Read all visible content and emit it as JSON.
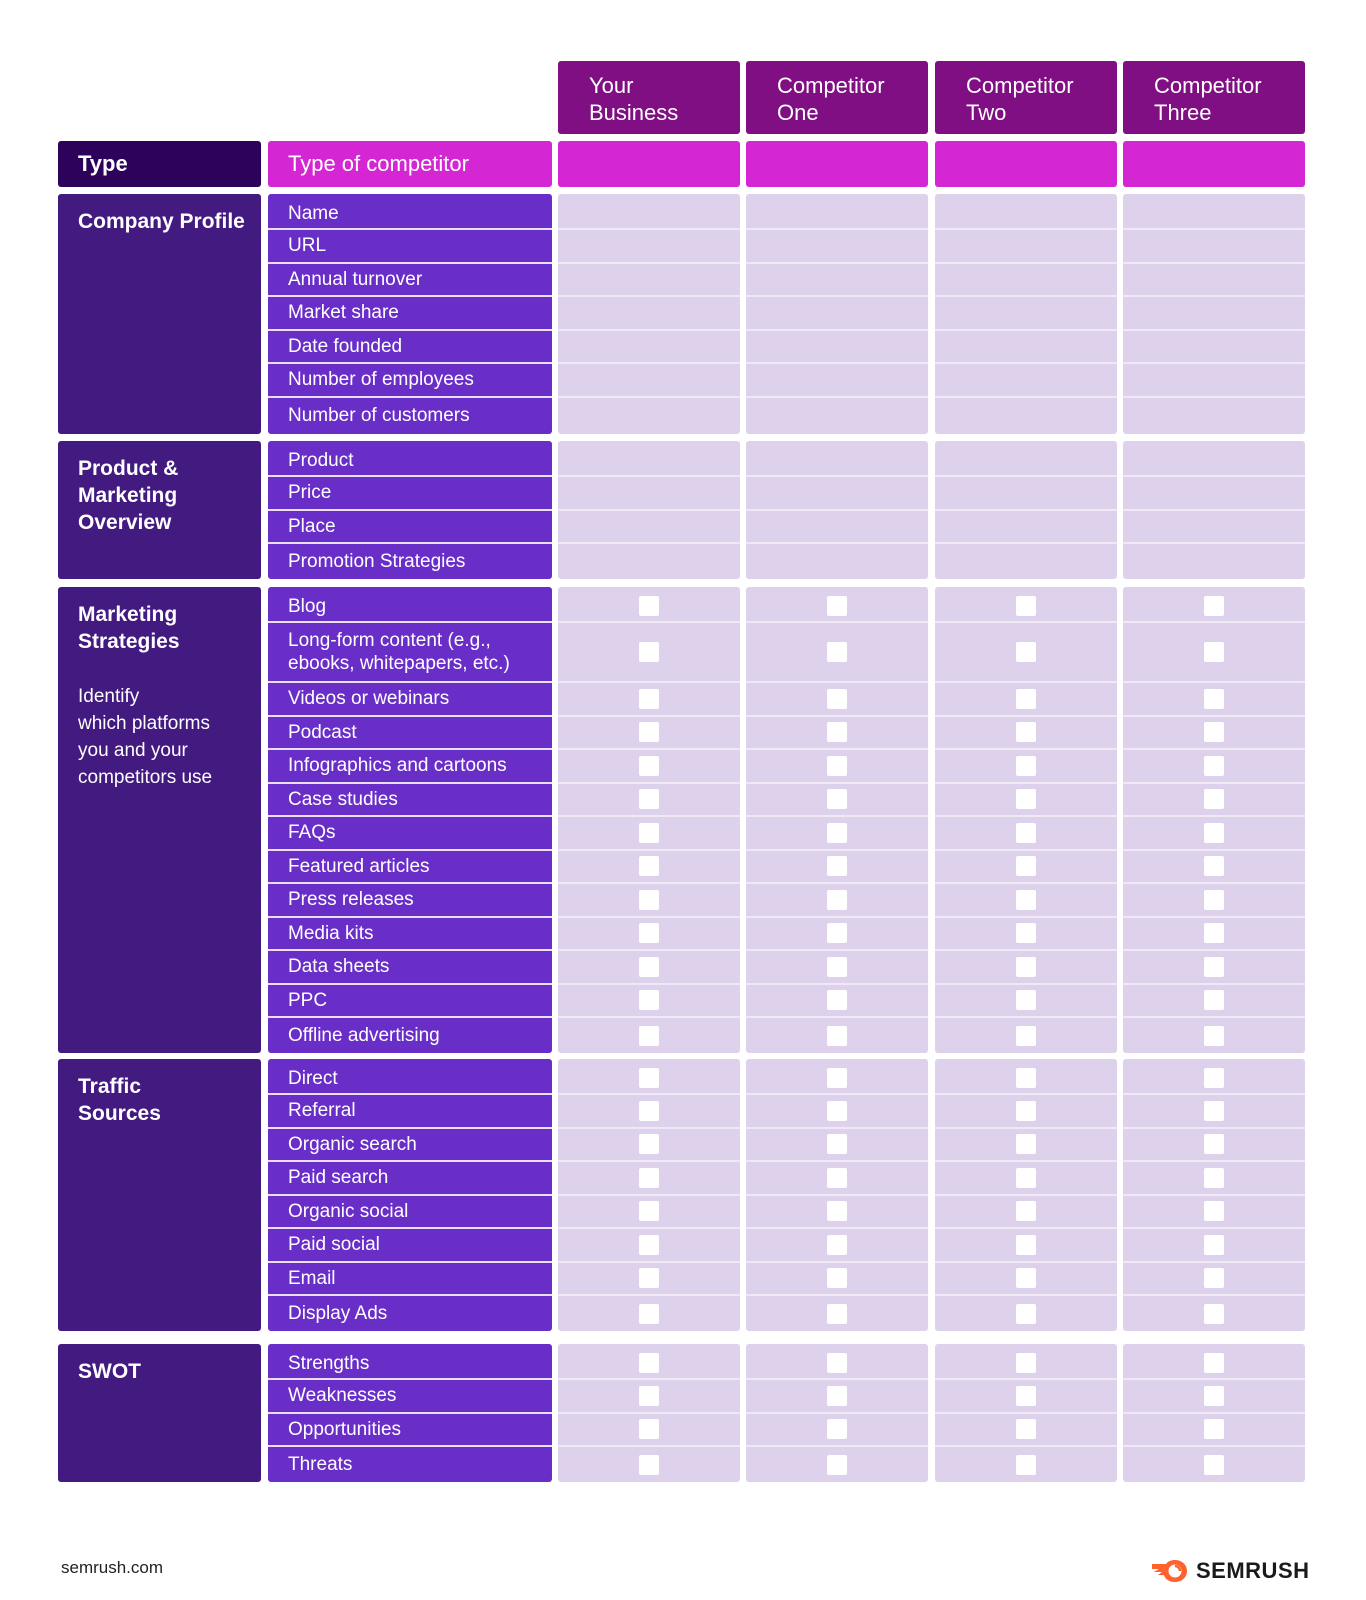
{
  "columns": [
    "Your Business",
    "Competitor One",
    "Competitor Two",
    "Competitor Three"
  ],
  "columns_lines": [
    [
      "Your",
      "Business"
    ],
    [
      "Competitor",
      "One"
    ],
    [
      "Competitor",
      "Two"
    ],
    [
      "Competitor",
      "Three"
    ]
  ],
  "type_label": "Type",
  "type_of_competitor_label": "Type of competitor",
  "colors": {
    "column_header": "#7f0f82",
    "pink_header": "#d427d3",
    "type_box": "#2d025a",
    "section_label": "#421a80",
    "row_label": "#6a2ec8",
    "cell": "#ddd1ec",
    "checkbox": "#ffffff",
    "logo_orange": "#ff622d"
  },
  "sections": [
    {
      "title_lines": [
        "Company Profile"
      ],
      "description_lines": [],
      "checkboxes": false,
      "rows": [
        "Name",
        "URL",
        "Annual turnover",
        "Market share",
        "Date founded",
        "Number of employees",
        "Number of customers"
      ]
    },
    {
      "title_lines": [
        "Product &",
        "Marketing",
        "Overview"
      ],
      "description_lines": [],
      "checkboxes": false,
      "rows": [
        "Product",
        "Price",
        "Place",
        "Promotion Strategies"
      ]
    },
    {
      "title_lines": [
        "Marketing",
        "Strategies"
      ],
      "description_lines": [
        "Identify",
        "which platforms",
        "you and your",
        "competitors use"
      ],
      "checkboxes": true,
      "rows": [
        "Blog",
        "Long-form content (e.g., ebooks, whitepapers, etc.)",
        "Videos or webinars",
        "Podcast",
        "Infographics and cartoons",
        "Case studies",
        "FAQs",
        "Featured articles",
        "Press releases",
        "Media kits",
        "Data sheets",
        "PPC",
        "Offline advertising"
      ]
    },
    {
      "title_lines": [
        "Traffic",
        "Sources"
      ],
      "description_lines": [],
      "checkboxes": true,
      "rows": [
        "Direct",
        "Referral",
        "Organic search",
        "Paid search",
        "Organic social",
        "Paid social",
        "Email",
        "Display Ads"
      ]
    },
    {
      "title_lines": [
        "SWOT"
      ],
      "description_lines": [],
      "checkboxes": true,
      "rows": [
        "Strengths",
        "Weaknesses",
        "Opportunities",
        "Threats"
      ]
    }
  ],
  "footer": {
    "url": "semrush.com",
    "logo_text": "SEMRUSH",
    "logo_icon": "semrush-flame-icon"
  }
}
